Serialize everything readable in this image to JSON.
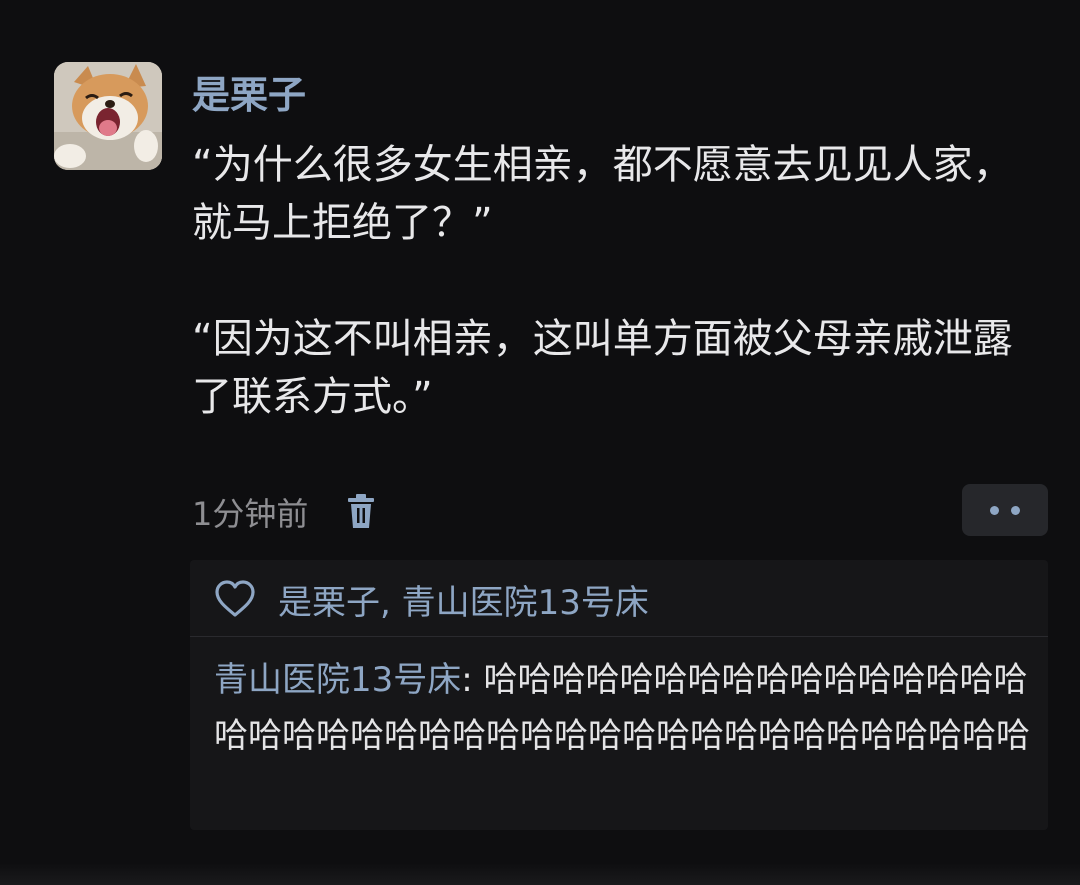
{
  "post": {
    "author": "是栗子",
    "paragraphs": [
      "“为什么很多女生相亲，都不愿意去见见人家，就马上拒绝了？”",
      "“因为这不叫相亲，这叫单方面被父母亲戚泄露了联系方式。”"
    ],
    "timestamp": "1分钟前",
    "icons": {
      "avatar": "shiba-dog-avatar",
      "delete": "trash-icon",
      "more": "more-dots-icon",
      "like": "heart-icon"
    },
    "colors": {
      "background": "#0e0e10",
      "accent": "#8ea6c4",
      "text": "#e8e8ea",
      "muted": "#8e8e92"
    }
  },
  "reactions": {
    "liked_by": "是栗子, 青山医院13号床",
    "comments": [
      {
        "name": "青山医院13号床",
        "separator": ": ",
        "text": "哈哈哈哈哈哈哈哈哈哈哈哈哈哈哈哈哈哈哈哈哈哈哈哈哈哈哈哈哈哈哈哈哈哈哈哈哈哈哈哈"
      }
    ]
  }
}
